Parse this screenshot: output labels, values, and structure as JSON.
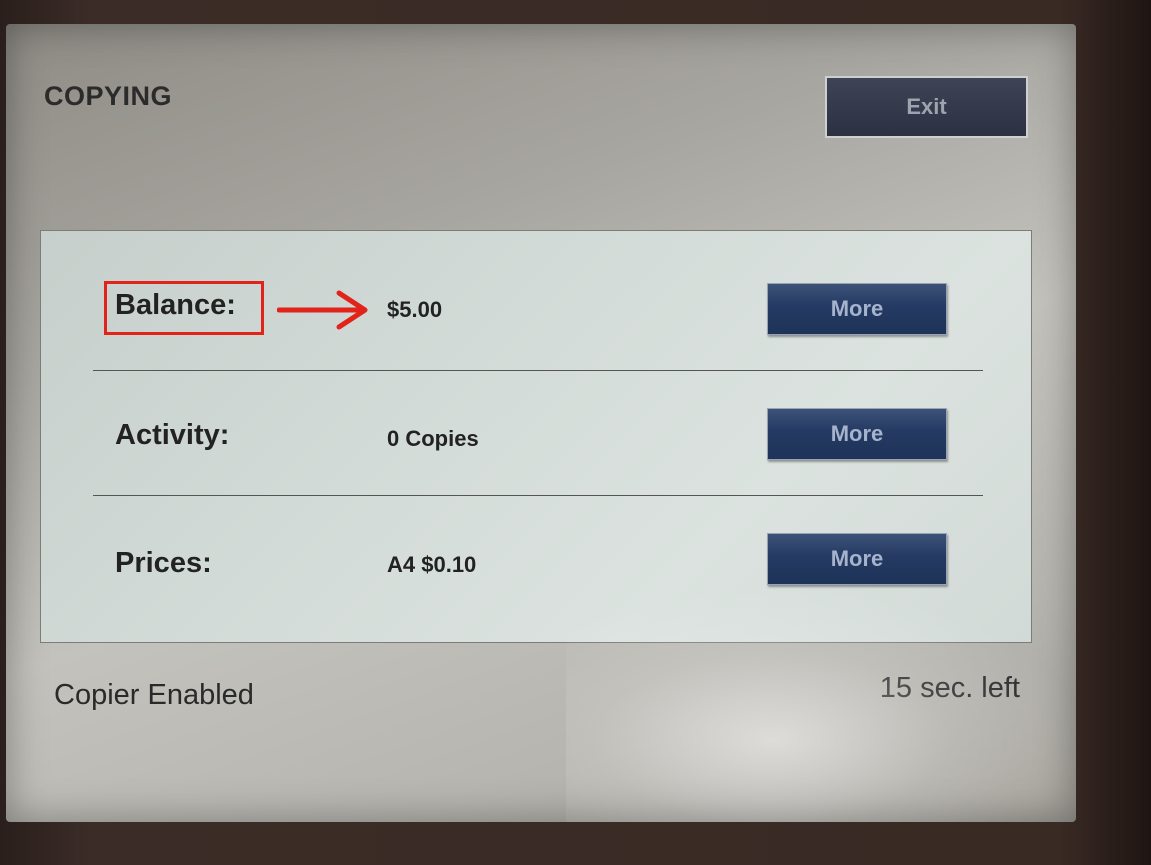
{
  "header": {
    "title": "COPYING",
    "exit_label": "Exit"
  },
  "rows": [
    {
      "label": "Balance:",
      "value": "$5.00",
      "button": "More"
    },
    {
      "label": "Activity:",
      "value": "0 Copies",
      "button": "More"
    },
    {
      "label": "Prices:",
      "value": "A4 $0.10",
      "button": "More"
    }
  ],
  "footer": {
    "status": "Copier Enabled",
    "timer": "15 sec. left"
  },
  "annotation": {
    "highlight_color": "#e2231a"
  }
}
